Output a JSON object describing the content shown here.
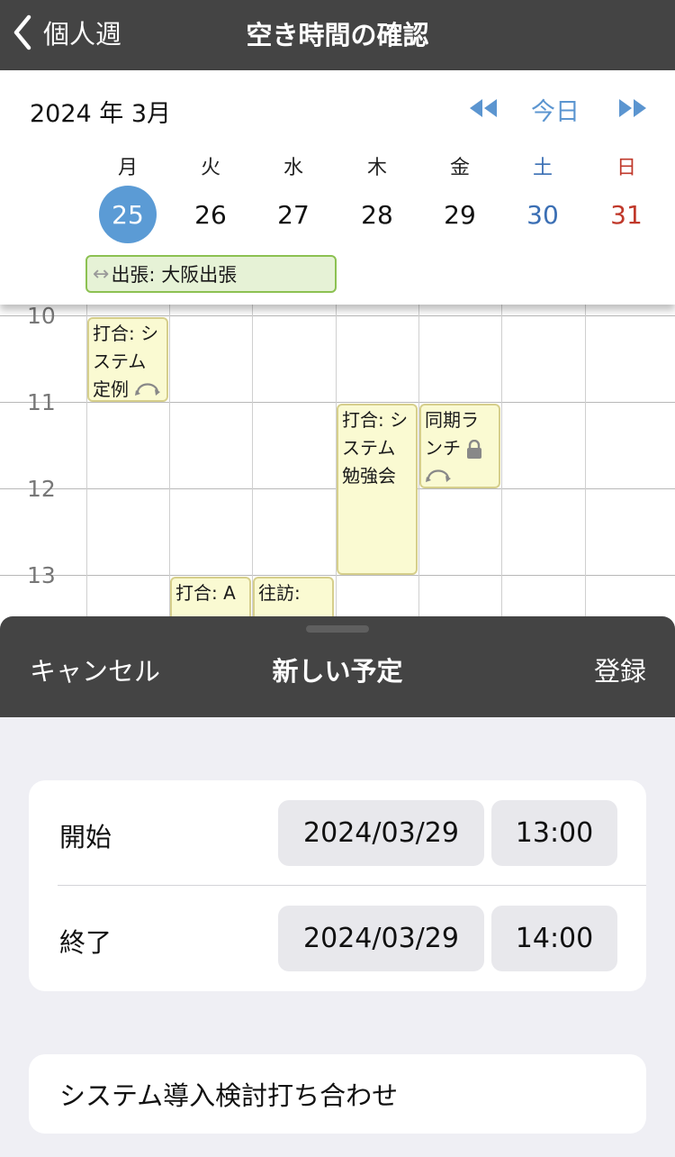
{
  "topbar": {
    "back_label": "個人週",
    "title": "空き時間の確認"
  },
  "week": {
    "month": "2024 年 3月",
    "today_label": "今日",
    "days": [
      {
        "dow": "月",
        "date": "25",
        "selected": true
      },
      {
        "dow": "火",
        "date": "26"
      },
      {
        "dow": "水",
        "date": "27"
      },
      {
        "dow": "木",
        "date": "28"
      },
      {
        "dow": "金",
        "date": "29"
      },
      {
        "dow": "土",
        "date": "30",
        "kind": "sat"
      },
      {
        "dow": "日",
        "date": "31",
        "kind": "sun"
      }
    ],
    "allday_event": {
      "arrow": "↔",
      "label": "出張: 大阪出張"
    }
  },
  "grid": {
    "hours": [
      "10",
      "11",
      "12",
      "13"
    ],
    "events": [
      {
        "line1": "打合: シ",
        "line2": "ステム",
        "line3": "定例"
      },
      {
        "line1": "打合: シ",
        "line2": "ステム",
        "line3": "勉強会"
      },
      {
        "line1": "同期ラ",
        "line2": "ンチ"
      },
      {
        "line1": "打合: A"
      },
      {
        "line1": "往訪:"
      }
    ]
  },
  "sheet": {
    "cancel": "キャンセル",
    "title": "新しい予定",
    "save": "登録",
    "start": {
      "label": "開始",
      "date": "2024/03/29",
      "time": "13:00"
    },
    "end": {
      "label": "終了",
      "date": "2024/03/29",
      "time": "14:00"
    },
    "event_title": "システム導入検討打ち合わせ"
  },
  "colors": {
    "bar": "#444444",
    "accent": "#5b9bd5",
    "saturday": "#3b6fb4",
    "sunday": "#c0392b",
    "event_fill": "#fafad2",
    "allday_fill": "#e6f2d6"
  }
}
